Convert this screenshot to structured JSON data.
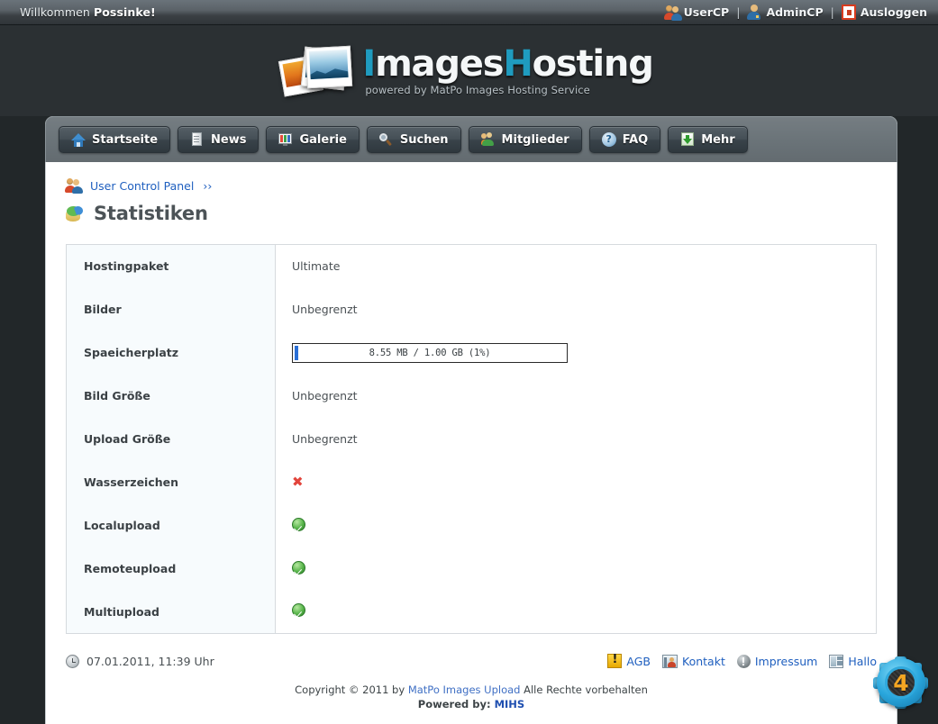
{
  "topbar": {
    "welcome_prefix": "Willkommen ",
    "username": "Possinke!",
    "usercp": "UserCP",
    "admincp": "AdminCP",
    "logout": "Ausloggen",
    "separator": "|"
  },
  "logo": {
    "part1_accent": "I",
    "part1": "mages",
    "part2_accent": "H",
    "part2": "osting",
    "tagline": "powered by MatPo Images Hosting Service",
    "accent_color": "#1f9bbf"
  },
  "nav": {
    "items": [
      {
        "label": "Startseite",
        "icon": "home-icon"
      },
      {
        "label": "News",
        "icon": "news-icon"
      },
      {
        "label": "Galerie",
        "icon": "gallery-icon"
      },
      {
        "label": "Suchen",
        "icon": "search-icon"
      },
      {
        "label": "Mitglieder",
        "icon": "members-icon"
      },
      {
        "label": "FAQ",
        "icon": "faq-icon"
      },
      {
        "label": "Mehr",
        "icon": "download-arrow-icon"
      }
    ]
  },
  "breadcrumb": {
    "link": "User Control Panel",
    "chevron": "››",
    "icon": "users-icon"
  },
  "page": {
    "title": "Statistiken",
    "icon": "statistics-pie-icon"
  },
  "stats": {
    "rows": [
      {
        "label": "Hostingpaket",
        "type": "text",
        "value": "Ultimate"
      },
      {
        "label": "Bilder",
        "type": "text",
        "value": "Unbegrenzt"
      },
      {
        "label": "Spaeicherplatz",
        "type": "progress",
        "value": "8.55 MB / 1.00 GB (1%)"
      },
      {
        "label": "Bild Größe",
        "type": "text",
        "value": "Unbegrenzt"
      },
      {
        "label": "Upload Größe",
        "type": "text",
        "value": "Unbegrenzt"
      },
      {
        "label": "Wasserzeichen",
        "type": "cross",
        "value": "✖"
      },
      {
        "label": "Localupload",
        "type": "check",
        "value": ""
      },
      {
        "label": "Remoteupload",
        "type": "check",
        "value": ""
      },
      {
        "label": "Multiupload",
        "type": "check",
        "value": ""
      }
    ],
    "progress": {
      "used": "8.55 MB",
      "total": "1.00 GB",
      "percent": 1,
      "text": "8.55 MB / 1.00 GB (1%)",
      "fill_color": "#2a6fd6"
    },
    "cross_color": "#e2453c",
    "check_color": "#57b44a"
  },
  "footer": {
    "timestamp": "07.01.2011, 11:39 Uhr",
    "clock_icon": "clock-icon",
    "links": [
      {
        "label": "AGB",
        "icon": "warning-icon"
      },
      {
        "label": "Kontakt",
        "icon": "contact-card-icon"
      },
      {
        "label": "Impressum",
        "icon": "info-icon"
      },
      {
        "label": "Hallo",
        "icon": "layout-icon"
      }
    ],
    "copyright_pre": "Copyright © 2011 by ",
    "copyright_link": "MatPo Images Upload",
    "copyright_post": " Alle Rechte vorbehalten",
    "powered_label": "Powered by: ",
    "powered_link": "MIHS"
  },
  "badge": {
    "number": "4",
    "name": "gear-badge"
  }
}
